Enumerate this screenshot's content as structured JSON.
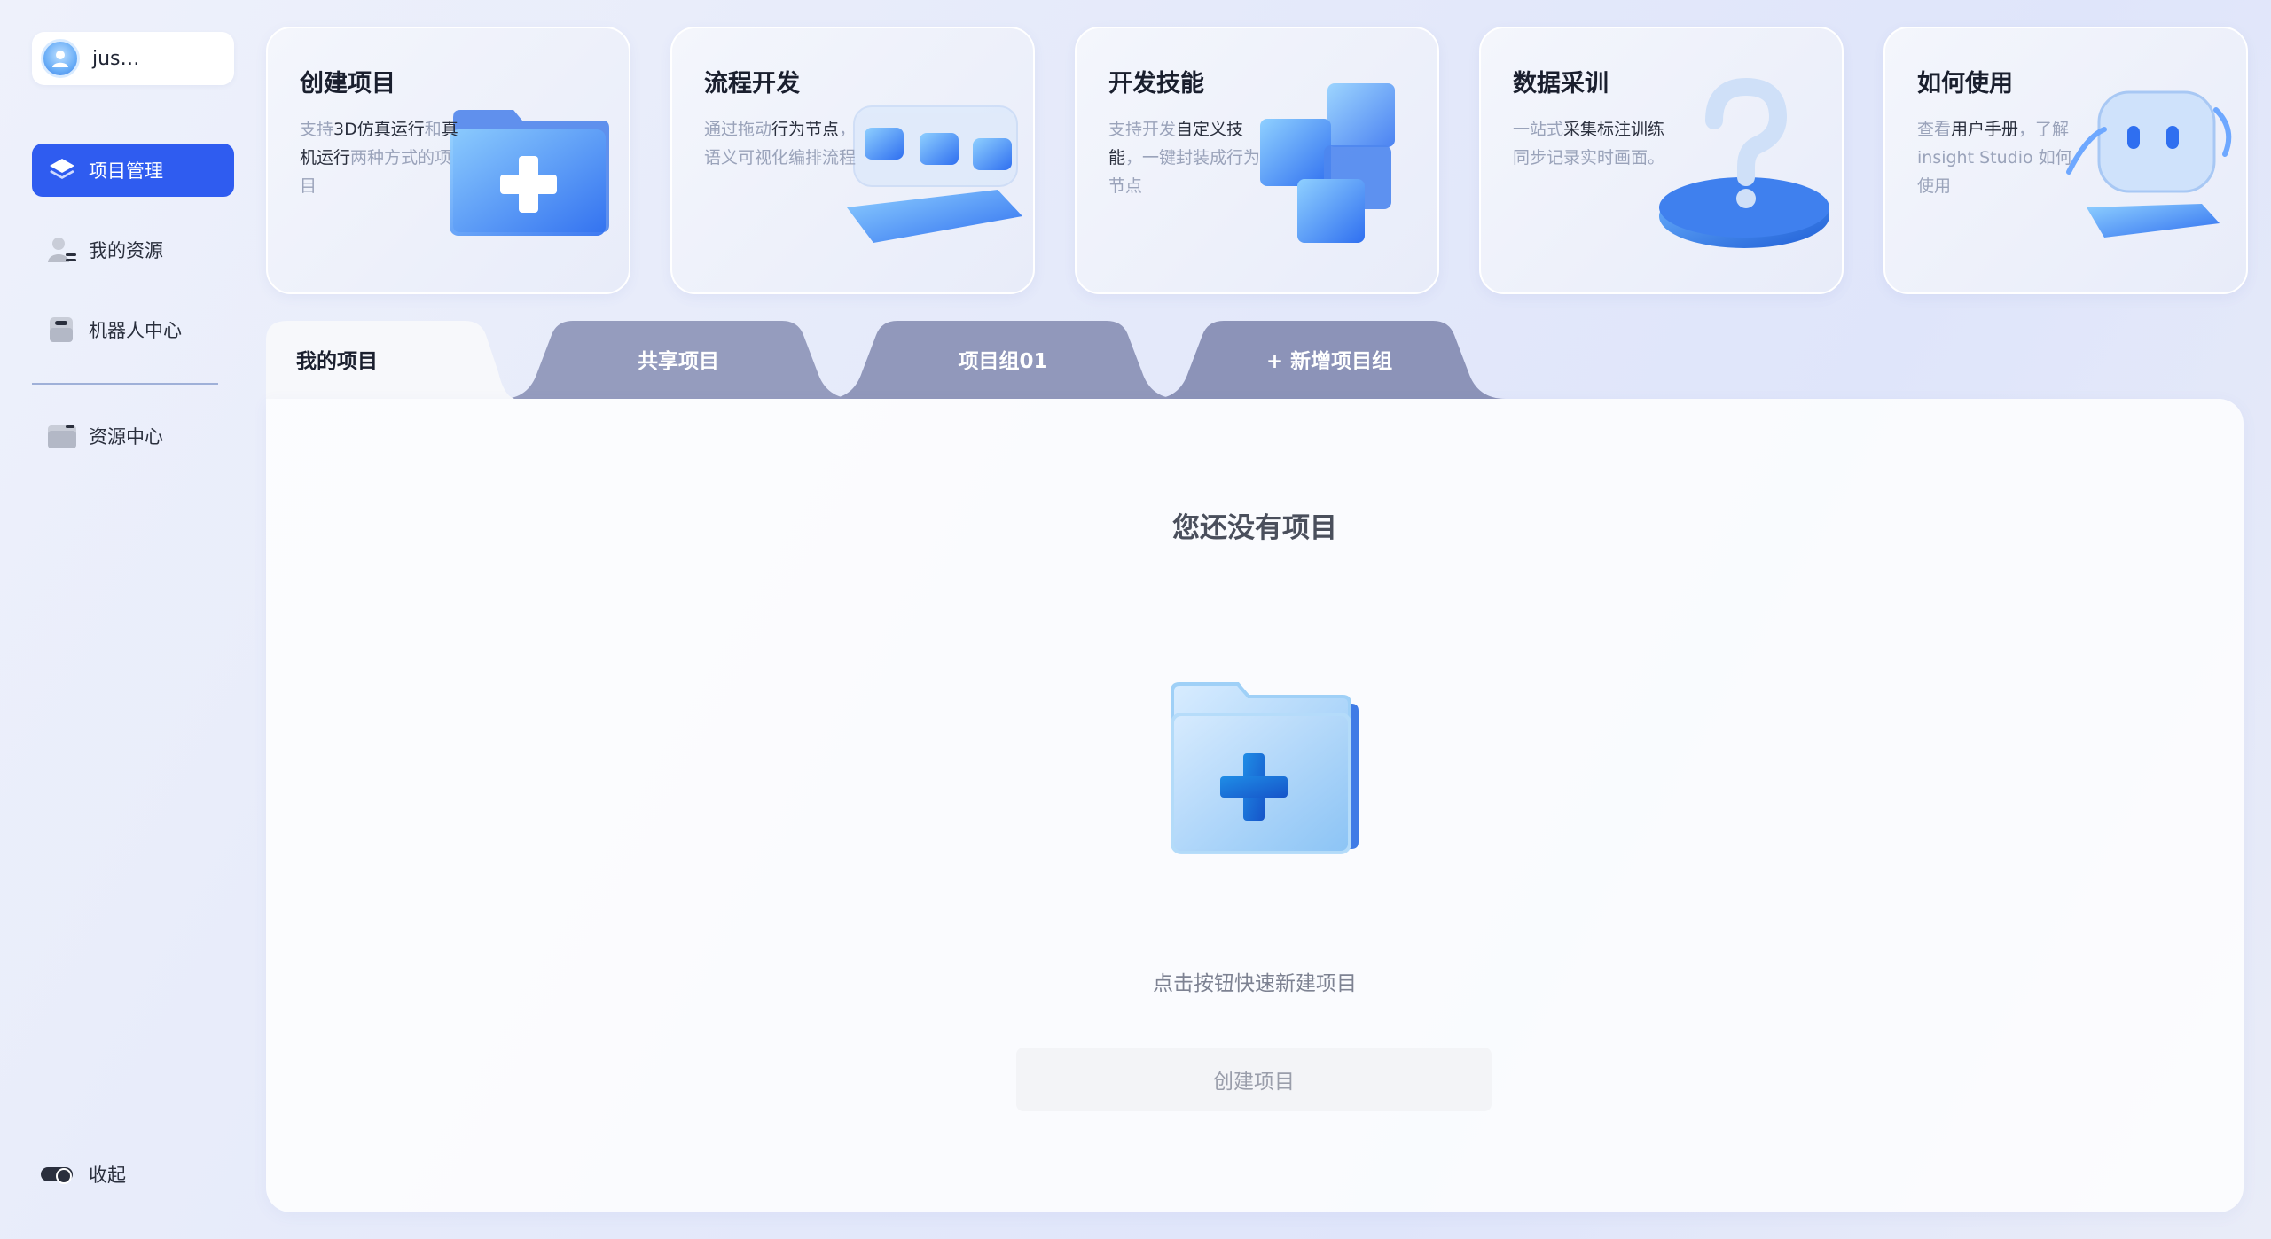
{
  "user": {
    "name": "jus…"
  },
  "nav": {
    "items": [
      {
        "label": "项目管理",
        "icon": "layers-icon",
        "active": true
      },
      {
        "label": "我的资源",
        "icon": "user-resource-icon",
        "active": false
      },
      {
        "label": "机器人中心",
        "icon": "robot-icon",
        "active": false
      }
    ],
    "bottom_items": [
      {
        "label": "资源中心",
        "icon": "folder-icon"
      }
    ],
    "collapse_label": "收起"
  },
  "cards": [
    {
      "title": "创建项目",
      "desc_parts": [
        [
          "支持",
          false
        ],
        [
          "3D仿真运行",
          true
        ],
        [
          "和",
          false
        ],
        [
          "真机运行",
          true
        ],
        [
          "两种方式的项目",
          false
        ]
      ],
      "art": "folder-plus-icon"
    },
    {
      "title": "流程开发",
      "desc_parts": [
        [
          "通过拖动",
          false
        ],
        [
          "行为节点",
          true
        ],
        [
          "，语义可视化编排流程",
          false
        ]
      ],
      "art": "nodes-icon"
    },
    {
      "title": "开发技能",
      "desc_parts": [
        [
          "支持开发",
          false
        ],
        [
          "自定义技能",
          true
        ],
        [
          "，一键封装成行为节点",
          false
        ]
      ],
      "art": "cubes-icon"
    },
    {
      "title": "数据采训",
      "desc_parts": [
        [
          "一站式",
          false
        ],
        [
          "采集标注训练",
          true
        ],
        [
          "同步记录实时画面。",
          false
        ]
      ],
      "art": "question-icon"
    },
    {
      "title": "如何使用",
      "desc_parts": [
        [
          "查看",
          false
        ],
        [
          "用户手册",
          true
        ],
        [
          "，了解 insight Studio 如何使用",
          false
        ]
      ],
      "art": "robot-face-icon"
    }
  ],
  "tabs": [
    {
      "label": "我的项目",
      "active": true
    },
    {
      "label": "共享项目",
      "active": false
    },
    {
      "label": "项目组01",
      "active": false
    },
    {
      "label": "+ 新增项目组",
      "active": false
    }
  ],
  "empty": {
    "title": "您还没有项目",
    "hint": "点击按钮快速新建项目",
    "button_label": "创建项目"
  },
  "colors": {
    "accent": "#2f5cf0",
    "tab_inactive": "#8c93b8"
  }
}
